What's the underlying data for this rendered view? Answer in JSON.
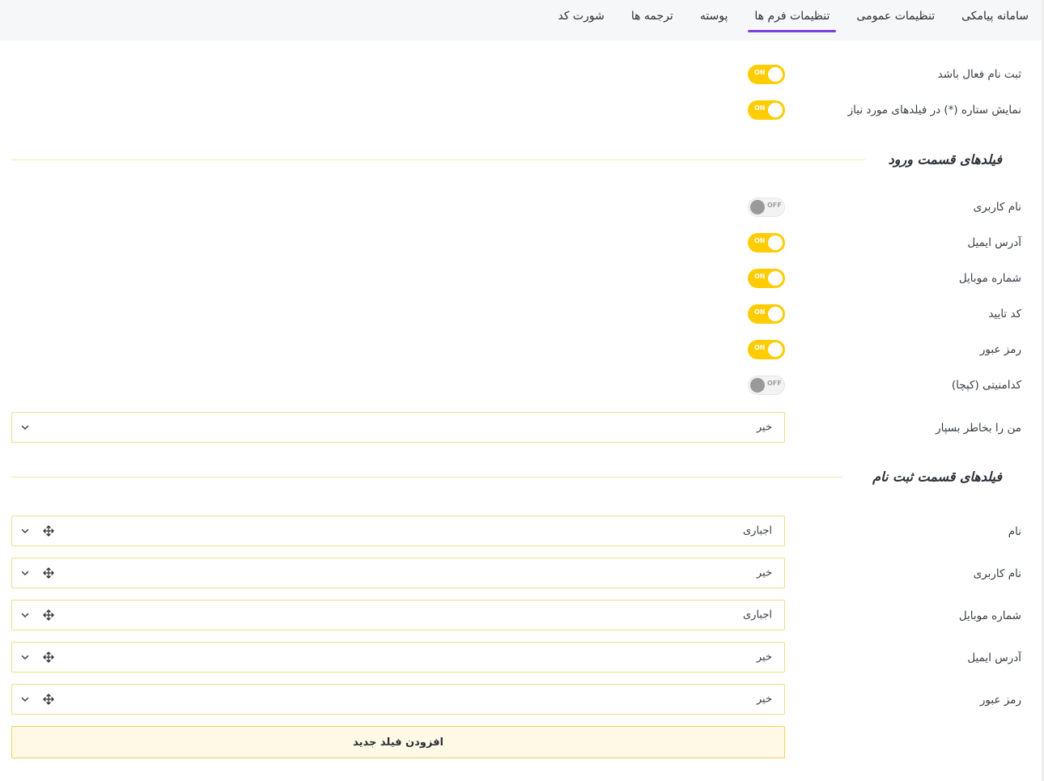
{
  "tabs": [
    {
      "label": "سامانه پیامکی",
      "active": false
    },
    {
      "label": "تنظیمات عمومی",
      "active": false
    },
    {
      "label": "تنظیمات فرم ها",
      "active": true
    },
    {
      "label": "پوسته",
      "active": false
    },
    {
      "label": "ترجمه ها",
      "active": false
    },
    {
      "label": "شورت کد",
      "active": false
    }
  ],
  "general": {
    "registration_enabled": {
      "label": "ثبت نام فعال باشد",
      "state": "ON"
    },
    "show_asterisk": {
      "label": "نمایش ستاره (*) در فیلدهای مورد نیاز",
      "state": "ON"
    }
  },
  "login_section": {
    "title": "فیلدهای قسمت ورود",
    "fields": [
      {
        "label": "نام کاربری",
        "state": "OFF"
      },
      {
        "label": "آدرس ایمیل",
        "state": "ON"
      },
      {
        "label": "شماره موبایل",
        "state": "ON"
      },
      {
        "label": "کد تایید",
        "state": "ON"
      },
      {
        "label": "رمز عبور",
        "state": "ON"
      },
      {
        "label": "کدامنیتی (کپچا)",
        "state": "OFF"
      }
    ],
    "remember_me": {
      "label": "من را بخاطر بسپار",
      "value": "خیر"
    }
  },
  "register_section": {
    "title": "فیلدهای قسمت ثبت نام",
    "fields": [
      {
        "label": "نام",
        "value": "اجباری"
      },
      {
        "label": "نام کاربری",
        "value": "خیر"
      },
      {
        "label": "شماره موبایل",
        "value": "اجباری"
      },
      {
        "label": "آدرس ایمیل",
        "value": "خیر"
      },
      {
        "label": "رمز عبور",
        "value": "خیر"
      }
    ],
    "add_button": "افزودن فیلد جدید"
  },
  "colors": {
    "accent": "#7b3fe4",
    "toggle_on": "#ffcc00",
    "border": "#f3dd86"
  },
  "icons": {
    "dropdown": "chevron-down-icon",
    "reorder": "move-icon"
  }
}
